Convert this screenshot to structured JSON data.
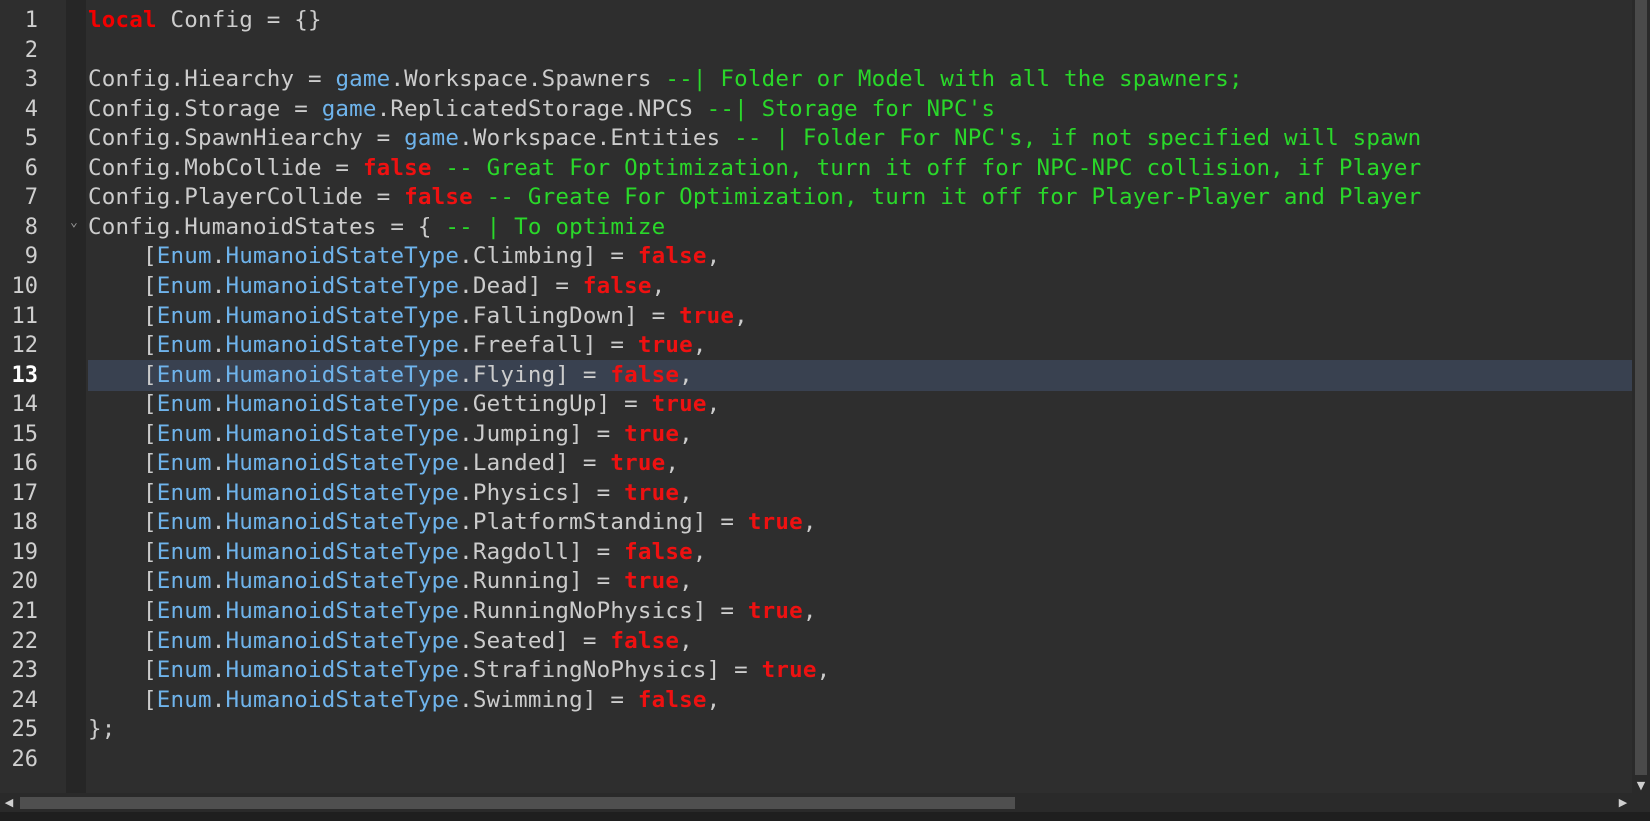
{
  "editor": {
    "current_line": 13,
    "line_numbers": [
      "1",
      "2",
      "3",
      "4",
      "5",
      "6",
      "7",
      "8",
      "9",
      "10",
      "11",
      "12",
      "13",
      "14",
      "15",
      "16",
      "17",
      "18",
      "19",
      "20",
      "21",
      "22",
      "23",
      "24",
      "25",
      "26"
    ],
    "lines": [
      [
        {
          "t": "local",
          "c": "kw"
        },
        {
          "t": " Config = {}"
        }
      ],
      [],
      [
        {
          "t": "Config.Hiearchy = "
        },
        {
          "t": "game",
          "c": "en"
        },
        {
          "t": ".Workspace.Spawners "
        },
        {
          "t": "--| Folder or Model with all the spawners;",
          "c": "cm"
        }
      ],
      [
        {
          "t": "Config.Storage = "
        },
        {
          "t": "game",
          "c": "en"
        },
        {
          "t": ".ReplicatedStorage.NPCS "
        },
        {
          "t": "--| Storage for NPC's",
          "c": "cm"
        }
      ],
      [
        {
          "t": "Config.SpawnHiearchy = "
        },
        {
          "t": "game",
          "c": "en"
        },
        {
          "t": ".Workspace.Entities "
        },
        {
          "t": "-- | Folder For NPC's, if not specified will spawn",
          "c": "cm"
        }
      ],
      [
        {
          "t": "Config.MobCollide = "
        },
        {
          "t": "false",
          "c": "bool"
        },
        {
          "t": " -- Great For Optimization, turn it off for NPC-NPC collision, if Player",
          "c": "cm"
        }
      ],
      [
        {
          "t": "Config.PlayerCollide = "
        },
        {
          "t": "false",
          "c": "bool"
        },
        {
          "t": " -- Greate For Optimization, turn it off for Player-Player and Player",
          "c": "cm"
        }
      ],
      [
        {
          "t": "Config.HumanoidStates = { "
        },
        {
          "t": "-- | To optimize",
          "c": "cm"
        }
      ],
      [
        {
          "t": "    ["
        },
        {
          "t": "Enum",
          "c": "en"
        },
        {
          "t": "."
        },
        {
          "t": "HumanoidStateType",
          "c": "en"
        },
        {
          "t": ".Climbing] = "
        },
        {
          "t": "false",
          "c": "bool"
        },
        {
          "t": ","
        }
      ],
      [
        {
          "t": "    ["
        },
        {
          "t": "Enum",
          "c": "en"
        },
        {
          "t": "."
        },
        {
          "t": "HumanoidStateType",
          "c": "en"
        },
        {
          "t": ".Dead] = "
        },
        {
          "t": "false",
          "c": "bool"
        },
        {
          "t": ","
        }
      ],
      [
        {
          "t": "    ["
        },
        {
          "t": "Enum",
          "c": "en"
        },
        {
          "t": "."
        },
        {
          "t": "HumanoidStateType",
          "c": "en"
        },
        {
          "t": ".FallingDown] = "
        },
        {
          "t": "true",
          "c": "bool"
        },
        {
          "t": ","
        }
      ],
      [
        {
          "t": "    ["
        },
        {
          "t": "Enum",
          "c": "en"
        },
        {
          "t": "."
        },
        {
          "t": "HumanoidStateType",
          "c": "en"
        },
        {
          "t": ".Freefall] = "
        },
        {
          "t": "true",
          "c": "bool"
        },
        {
          "t": ","
        }
      ],
      [
        {
          "t": "    ["
        },
        {
          "t": "Enum",
          "c": "en"
        },
        {
          "t": "."
        },
        {
          "t": "HumanoidStateType",
          "c": "en"
        },
        {
          "t": ".Flying] = "
        },
        {
          "t": "false",
          "c": "bool"
        },
        {
          "t": ","
        }
      ],
      [
        {
          "t": "    ["
        },
        {
          "t": "Enum",
          "c": "en"
        },
        {
          "t": "."
        },
        {
          "t": "HumanoidStateType",
          "c": "en"
        },
        {
          "t": ".GettingUp] = "
        },
        {
          "t": "true",
          "c": "bool"
        },
        {
          "t": ","
        }
      ],
      [
        {
          "t": "    ["
        },
        {
          "t": "Enum",
          "c": "en"
        },
        {
          "t": "."
        },
        {
          "t": "HumanoidStateType",
          "c": "en"
        },
        {
          "t": ".Jumping] = "
        },
        {
          "t": "true",
          "c": "bool"
        },
        {
          "t": ","
        }
      ],
      [
        {
          "t": "    ["
        },
        {
          "t": "Enum",
          "c": "en"
        },
        {
          "t": "."
        },
        {
          "t": "HumanoidStateType",
          "c": "en"
        },
        {
          "t": ".Landed] = "
        },
        {
          "t": "true",
          "c": "bool"
        },
        {
          "t": ","
        }
      ],
      [
        {
          "t": "    ["
        },
        {
          "t": "Enum",
          "c": "en"
        },
        {
          "t": "."
        },
        {
          "t": "HumanoidStateType",
          "c": "en"
        },
        {
          "t": ".Physics] = "
        },
        {
          "t": "true",
          "c": "bool"
        },
        {
          "t": ","
        }
      ],
      [
        {
          "t": "    ["
        },
        {
          "t": "Enum",
          "c": "en"
        },
        {
          "t": "."
        },
        {
          "t": "HumanoidStateType",
          "c": "en"
        },
        {
          "t": ".PlatformStanding] = "
        },
        {
          "t": "true",
          "c": "bool"
        },
        {
          "t": ","
        }
      ],
      [
        {
          "t": "    ["
        },
        {
          "t": "Enum",
          "c": "en"
        },
        {
          "t": "."
        },
        {
          "t": "HumanoidStateType",
          "c": "en"
        },
        {
          "t": ".Ragdoll] = "
        },
        {
          "t": "false",
          "c": "bool"
        },
        {
          "t": ","
        }
      ],
      [
        {
          "t": "    ["
        },
        {
          "t": "Enum",
          "c": "en"
        },
        {
          "t": "."
        },
        {
          "t": "HumanoidStateType",
          "c": "en"
        },
        {
          "t": ".Running] = "
        },
        {
          "t": "true",
          "c": "bool"
        },
        {
          "t": ","
        }
      ],
      [
        {
          "t": "    ["
        },
        {
          "t": "Enum",
          "c": "en"
        },
        {
          "t": "."
        },
        {
          "t": "HumanoidStateType",
          "c": "en"
        },
        {
          "t": ".RunningNoPhysics] = "
        },
        {
          "t": "true",
          "c": "bool"
        },
        {
          "t": ","
        }
      ],
      [
        {
          "t": "    ["
        },
        {
          "t": "Enum",
          "c": "en"
        },
        {
          "t": "."
        },
        {
          "t": "HumanoidStateType",
          "c": "en"
        },
        {
          "t": ".Seated] = "
        },
        {
          "t": "false",
          "c": "bool"
        },
        {
          "t": ","
        }
      ],
      [
        {
          "t": "    ["
        },
        {
          "t": "Enum",
          "c": "en"
        },
        {
          "t": "."
        },
        {
          "t": "HumanoidStateType",
          "c": "en"
        },
        {
          "t": ".StrafingNoPhysics] = "
        },
        {
          "t": "true",
          "c": "bool"
        },
        {
          "t": ","
        }
      ],
      [
        {
          "t": "    ["
        },
        {
          "t": "Enum",
          "c": "en"
        },
        {
          "t": "."
        },
        {
          "t": "HumanoidStateType",
          "c": "en"
        },
        {
          "t": ".Swimming] = "
        },
        {
          "t": "false",
          "c": "bool"
        },
        {
          "t": ","
        }
      ],
      [
        {
          "t": "};"
        }
      ],
      []
    ],
    "fold_marker_line": 8,
    "fold_glyph": "⌄"
  },
  "scrollbars": {
    "up_arrow": "▲",
    "down_arrow": "▼",
    "left_arrow": "◀",
    "right_arrow": "▶"
  },
  "colors": {
    "background": "#2e2e2e",
    "keyword": "#f20000",
    "boolean": "#ee1111",
    "comment": "#2ad82a",
    "builtin": "#6fb4ec",
    "text": "#cccccc",
    "current_line": "#394150"
  }
}
